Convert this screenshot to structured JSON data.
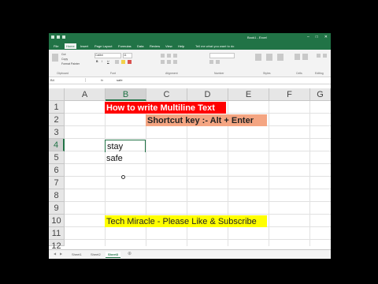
{
  "window": {
    "title": "Book1 - Excel"
  },
  "tabs": [
    "File",
    "Home",
    "Insert",
    "Page Layout",
    "Formulas",
    "Data",
    "Review",
    "View",
    "Help"
  ],
  "active_tab": "Home",
  "tell_me": "Tell me what you want to do",
  "ribbon": {
    "cut": "Cut",
    "copy": "Copy",
    "format_painter": "Format Painter",
    "font_name": "Calibri",
    "font_size": "11",
    "bold": "B",
    "italic": "I",
    "underline": "U",
    "groups": {
      "clipboard": "Clipboard",
      "font": "Font",
      "alignment": "Alignment",
      "number": "Number",
      "styles": "Styles",
      "cells": "Cells",
      "editing": "Editing"
    }
  },
  "formula_bar": {
    "name_box": "B4",
    "fx": "fx",
    "value": "safe"
  },
  "columns": [
    "A",
    "B",
    "C",
    "D",
    "E",
    "F",
    "G"
  ],
  "rows": [
    "1",
    "2",
    "3",
    "4",
    "5",
    "6",
    "7",
    "8",
    "9",
    "10",
    "11",
    "12"
  ],
  "cells": {
    "b1": "How to write Multiline Text",
    "c2": "Shortcut key :- Alt + Enter",
    "b4": "stay",
    "b5": "safe",
    "b11": "Tech Miracle - Please Like & Subscribe"
  },
  "sheets": [
    "Sheet1",
    "Sheet2",
    "Sheet3"
  ],
  "active_sheet": "Sheet3",
  "colors": {
    "excel_green": "#217346",
    "title_fill": "#ff0000",
    "shortcut_fill": "#f4a582",
    "footer_fill": "#ffff00"
  }
}
